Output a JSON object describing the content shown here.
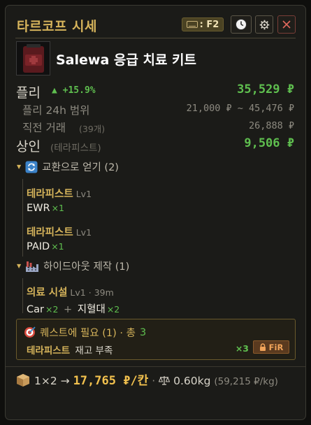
{
  "header": {
    "title": "타르코프 시세",
    "hotkey_label": ": F2"
  },
  "item": {
    "name": "Salewa 응급 치료 키트",
    "thumb_label": "Salewa"
  },
  "flea": {
    "label": "플리",
    "change": "▲ +15.9%",
    "price": "35,529 ₽"
  },
  "range": {
    "label": "플리 24h 범위",
    "value": "21,000 ₽ ~ 45,476 ₽"
  },
  "last_trade": {
    "label": "직전 거래",
    "count": "(39개)",
    "value": "26,888 ₽"
  },
  "trader_sell": {
    "label": "상인",
    "trader": "(테라피스트)",
    "price": "9,506 ₽"
  },
  "barter": {
    "title": "교환으로 얻기 (2)",
    "offers": [
      {
        "trader": "테라피스트",
        "level": "Lv1",
        "item": "EWR",
        "qty": "×1"
      },
      {
        "trader": "테라피스트",
        "level": "Lv1",
        "item": "PAID",
        "qty": "×1"
      }
    ]
  },
  "hideout": {
    "title": "하이드아웃 제작 (1)",
    "station": "의료 시설",
    "level": "Lv1",
    "sep": "·",
    "time": "39m",
    "inputs": [
      {
        "item": "Car",
        "qty": "×2"
      },
      {
        "item": "지혈대",
        "qty": "×2"
      }
    ],
    "plus": "+"
  },
  "quest": {
    "title": "퀘스트에 필요 (1) · 총",
    "total": "3",
    "trader": "테라피스트",
    "note": "재고 부족",
    "qty": "×3",
    "fir_label": "FiR"
  },
  "footer": {
    "size": "1×2 →",
    "per_slot": "17,765 ₽/칸",
    "dot": "·",
    "weight": "0.60kg",
    "per_kg": "(59,215 ₽/kg)"
  },
  "colors": {
    "accent": "#d6b45b",
    "positive": "#5fbf4f",
    "close": "#e0685c",
    "fir": "#f0a45a"
  },
  "icons": [
    "keyboard-icon",
    "clock-icon",
    "gear-icon",
    "close-icon",
    "refresh-icon",
    "factory-icon",
    "target-icon",
    "lock-icon",
    "box-icon",
    "scale-icon"
  ]
}
